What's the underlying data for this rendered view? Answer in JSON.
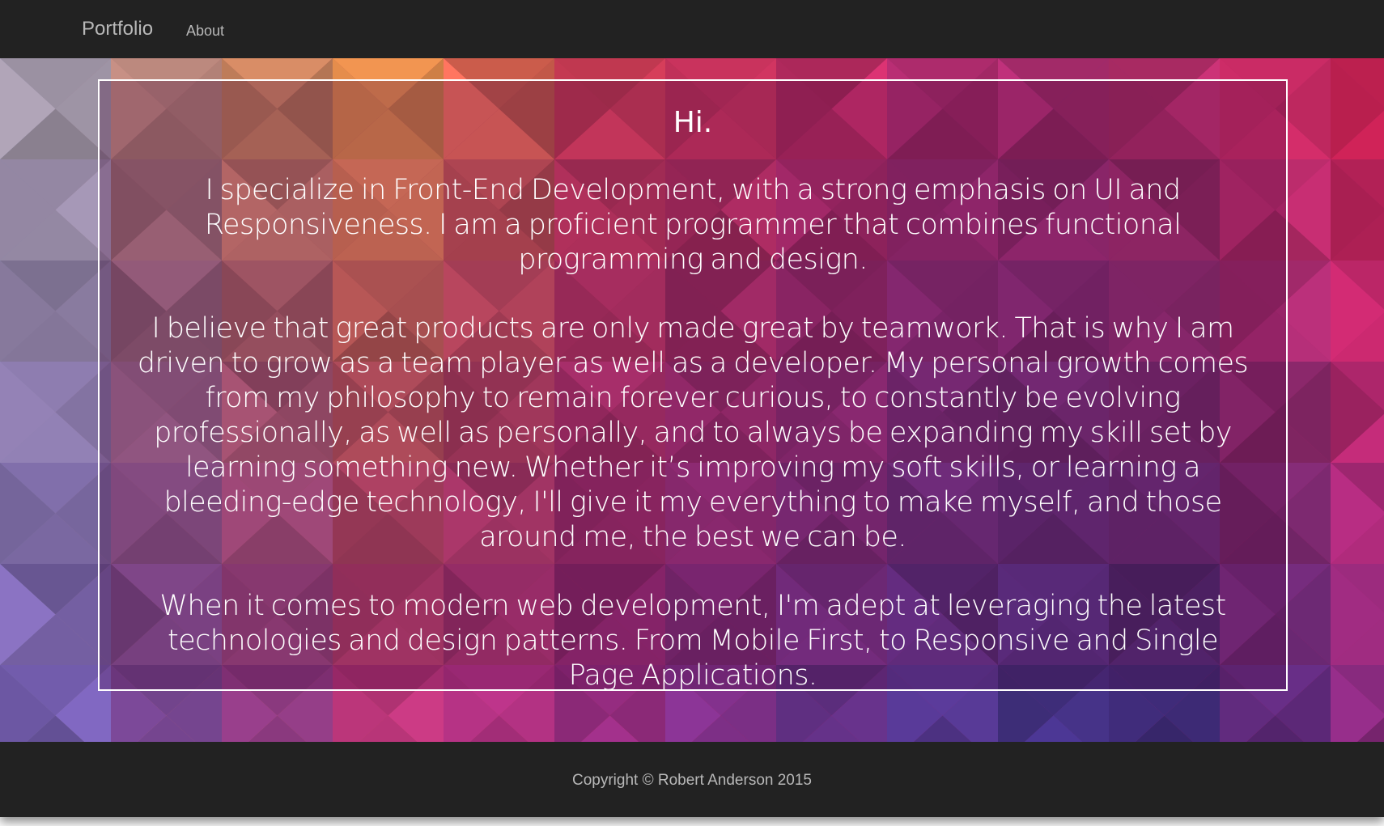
{
  "navbar": {
    "brand": "Portfolio",
    "links": [
      "About"
    ]
  },
  "main": {
    "greeting": "Hi.",
    "paragraphs": [
      "I specialize in Front-End Development, with a strong emphasis on UI and Responsiveness. I am a proficient programmer that combines functional programming and design.",
      "I believe that great products are only made great by teamwork. That is why I am driven to grow as a team player as well as a developer. My personal growth comes from my philosophy to remain forever curious, to constantly be evolving professionally, as well as personally, and to always be expanding my skill set by learning something new. Whether it’s improving my soft skills, or learning a bleeding-edge technology, I'll give it my everything to make myself, and those around me, the best we can be.",
      "When it comes to modern web development, I'm adept at leveraging the latest technologies and design patterns. From Mobile First, to Responsive and Single Page Applications."
    ]
  },
  "footer": {
    "copyright": "Copyright © Robert Anderson 2015"
  },
  "colors": {
    "chrome": "#222222",
    "chrome_text": "#b8b8b8",
    "hero_text": "#ffffff",
    "background_palette": [
      "#8a97c0",
      "#c97a74",
      "#f08a4a",
      "#e8375e",
      "#a4246a",
      "#6a2e8a",
      "#3c2c7a",
      "#e0245a"
    ]
  }
}
